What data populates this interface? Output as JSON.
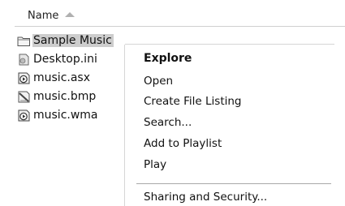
{
  "header": {
    "name_label": "Name",
    "sort_direction": "ascending"
  },
  "files": [
    {
      "name": "Sample Music",
      "icon": "folder-icon",
      "selected": true
    },
    {
      "name": "Desktop.ini",
      "icon": "settings-file-icon",
      "selected": false
    },
    {
      "name": "music.asx",
      "icon": "media-file-icon",
      "selected": false
    },
    {
      "name": "music.bmp",
      "icon": "bitmap-file-icon",
      "selected": false
    },
    {
      "name": "music.wma",
      "icon": "media-file-icon",
      "selected": false
    }
  ],
  "context_menu": {
    "items": [
      {
        "label": "Explore",
        "default": true
      },
      {
        "label": "Open"
      },
      {
        "label": "Create File Listing"
      },
      {
        "label": "Search..."
      },
      {
        "label": "Add to Playlist"
      },
      {
        "label": "Play"
      },
      {
        "label": "Sharing and Security..."
      }
    ]
  },
  "colors": {
    "selection": "#cdcdcd",
    "separator": "#a9a9a9",
    "header_border": "#cfcfcf"
  }
}
